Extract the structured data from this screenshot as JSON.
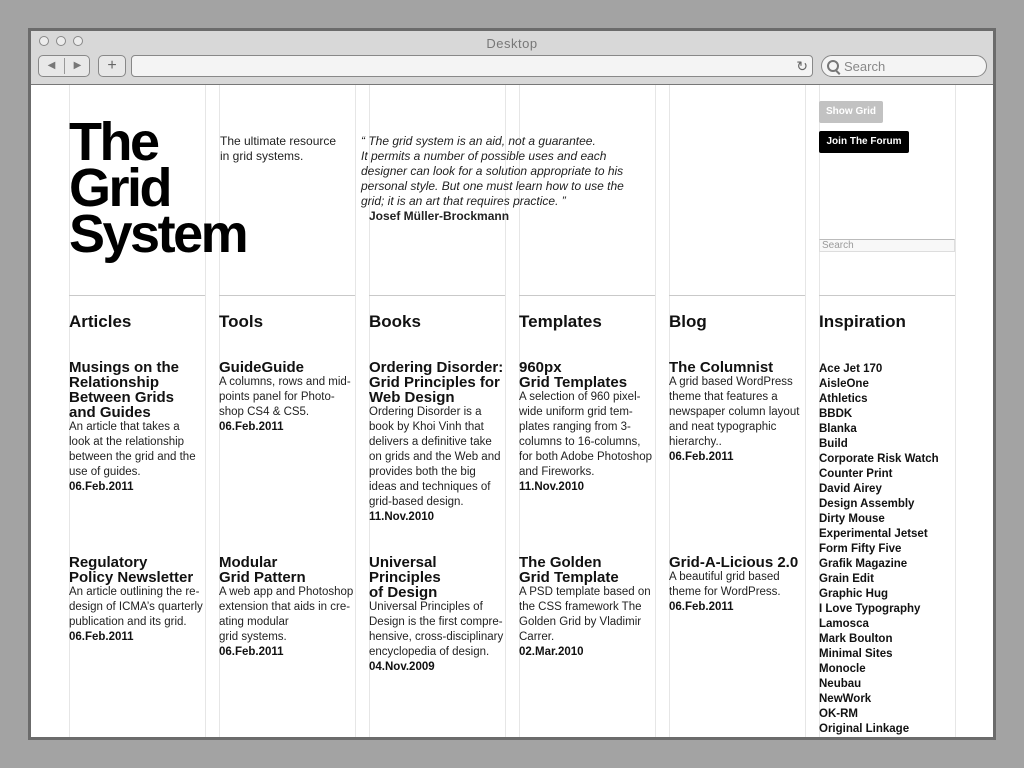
{
  "window": {
    "title": "Desktop",
    "search_placeholder": "Search"
  },
  "site": {
    "logo": [
      "The",
      "Grid",
      "System"
    ],
    "tagline": [
      "The ultimate resource",
      "in grid systems."
    ],
    "quote": {
      "lines": [
        "“ The grid system is an aid, not a guarantee.",
        "It permits a number of possible uses and each",
        "designer can look for a solution appropriate to his",
        "personal style. But one must learn how to use the",
        "grid; it is an art that requires practice. ”"
      ],
      "author": "Josef Müller-Brockmann"
    },
    "show_grid_label": "Show Grid",
    "join_forum_label": "Join The Forum",
    "site_search_placeholder": "Search"
  },
  "columns": {
    "articles": {
      "heading": "Articles",
      "items": [
        {
          "title": [
            "Musings on the",
            "Relationship",
            "Between Grids",
            "and Guides"
          ],
          "desc": [
            "An article that takes a",
            "look at the relationship",
            "between the grid and the",
            "use of guides."
          ],
          "date": "06.Feb.2011"
        },
        {
          "title": [
            "Regulatory",
            "Policy Newsletter"
          ],
          "desc": [
            "An article outlining the re-",
            "design of ICMA’s quarterly",
            "publication and its grid."
          ],
          "date": "06.Feb.2011"
        }
      ]
    },
    "tools": {
      "heading": "Tools",
      "items": [
        {
          "title": [
            "GuideGuide"
          ],
          "desc": [
            "A columns, rows and mid-",
            "points panel for Photo-",
            "shop CS4 & CS5."
          ],
          "date": "06.Feb.2011"
        },
        {
          "title": [
            "Modular",
            "Grid Pattern"
          ],
          "desc": [
            "A web app and Photoshop",
            "extension that aids in cre-",
            "ating modular",
            "grid systems."
          ],
          "date": "06.Feb.2011"
        }
      ]
    },
    "books": {
      "heading": "Books",
      "items": [
        {
          "title": [
            "Ordering Disorder:",
            "Grid Principles for",
            "Web Design"
          ],
          "desc": [
            "Ordering Disorder is a",
            "book by Khoi Vinh that",
            "delivers a definitive take",
            "on grids and the Web and",
            "provides both the big",
            "ideas and techniques of",
            "grid-based design."
          ],
          "date": "11.Nov.2010"
        },
        {
          "title": [
            "Universal",
            "Principles",
            "of Design"
          ],
          "desc": [
            "Universal Principles of",
            "Design is the first compre-",
            "hensive, cross-disciplinary",
            "encyclopedia of design."
          ],
          "date": "04.Nov.2009"
        }
      ]
    },
    "templates": {
      "heading": "Templates",
      "items": [
        {
          "title": [
            "960px",
            "Grid Templates"
          ],
          "desc": [
            "A selection of 960 pixel-",
            "wide uniform grid tem-",
            "plates ranging from 3-",
            "columns to 16-columns,",
            "for both Adobe Photoshop",
            "and Fireworks."
          ],
          "date": "11.Nov.2010"
        },
        {
          "title": [
            "The Golden",
            "Grid Template"
          ],
          "desc": [
            "A PSD template based on",
            "the CSS framework The",
            "Golden Grid by Vladimir",
            "Carrer."
          ],
          "date": "02.Mar.2010"
        }
      ]
    },
    "blog": {
      "heading": "Blog",
      "items": [
        {
          "title": [
            "The Columnist"
          ],
          "desc": [
            "A grid based WordPress",
            "theme that features a",
            "newspaper column layout",
            "and neat typographic",
            "hierarchy.."
          ],
          "date": "06.Feb.2011"
        },
        {
          "title": [
            "Grid-A-Licious 2.0"
          ],
          "desc": [
            "A beautiful grid based",
            "theme for WordPress."
          ],
          "date": "06.Feb.2011"
        }
      ]
    },
    "inspiration": {
      "heading": "Inspiration",
      "links": [
        "Ace Jet 170",
        "AisleOne",
        "Athletics",
        "BBDK",
        "Blanka",
        "Build",
        "Corporate Risk Watch",
        "Counter Print",
        "David Airey",
        "Design Assembly",
        "Dirty Mouse",
        "Experimental Jetset",
        "Form Fifty Five",
        "Grafik Magazine",
        "Grain Edit",
        "Graphic Hug",
        "I Love Typography",
        "Lamosca",
        "Mark Boulton",
        "Minimal Sites",
        "Monocle",
        "Neubau",
        "NewWork",
        "OK-RM",
        "Original Linkage"
      ]
    }
  }
}
